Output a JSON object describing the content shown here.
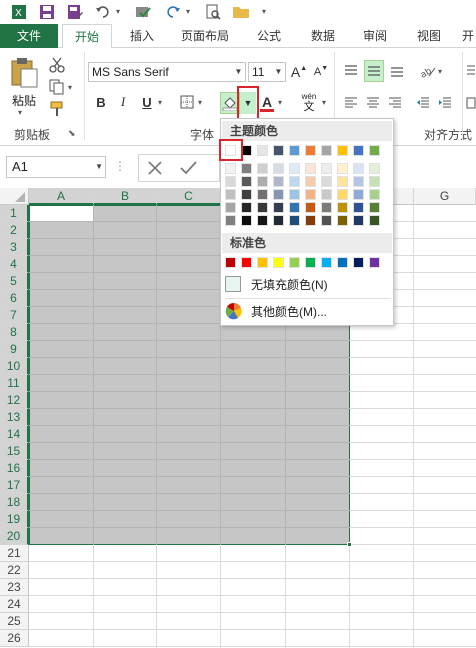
{
  "tabs": [
    "文件",
    "开始",
    "插入",
    "页面布局",
    "公式",
    "数据",
    "审阅",
    "视图",
    "开"
  ],
  "active_tab": "开始",
  "ribbon": {
    "paste_label": "粘贴",
    "clipboard_group": "剪贴板",
    "font_group": "字体",
    "align_group": "对齐方式",
    "font_name": "MS Sans Serif",
    "font_size": "11",
    "bold": "B",
    "italic": "I",
    "underline": "U",
    "font_color_glyph": "A",
    "wen_label": "wén",
    "wen_char": "文",
    "grow_font": "A",
    "shrink_font": "A"
  },
  "formula_bar": {
    "name_box": "A1"
  },
  "grid": {
    "columns": [
      "A",
      "B",
      "C",
      "D",
      "E",
      "F",
      "G"
    ],
    "rows": [
      "1",
      "2",
      "3",
      "4",
      "5",
      "6",
      "7",
      "8",
      "9",
      "10",
      "11",
      "12",
      "13",
      "14",
      "15",
      "16",
      "17",
      "18",
      "19",
      "20",
      "21",
      "22",
      "23",
      "24",
      "25",
      "26"
    ]
  },
  "dropdown": {
    "theme_title": "主题颜色",
    "standard_title": "标准色",
    "no_fill": "无填充颜色(N)",
    "more_colors": "其他颜色(M)...",
    "theme_top": [
      "#ffffff",
      "#000000",
      "#e7e6e6",
      "#44546a",
      "#5b9bd5",
      "#ed7d31",
      "#a5a5a5",
      "#ffc000",
      "#4472c4",
      "#70ad47"
    ],
    "theme_shades": [
      [
        "#f2f2f2",
        "#7f7f7f",
        "#d0cece",
        "#d6dce4",
        "#deebf6",
        "#fbe5d5",
        "#ededed",
        "#fff2cc",
        "#dae3f3",
        "#e2efd9"
      ],
      [
        "#d8d8d8",
        "#595959",
        "#aeabab",
        "#adb9ca",
        "#bdd7ee",
        "#f7cbac",
        "#dbdbdb",
        "#fee599",
        "#b4c6e7",
        "#c5e0b3"
      ],
      [
        "#bfbfbf",
        "#3f3f3f",
        "#757070",
        "#8496b0",
        "#9cc3e5",
        "#f4b183",
        "#c9c9c9",
        "#ffd965",
        "#8eaadb",
        "#a8d08d"
      ],
      [
        "#a5a5a5",
        "#262626",
        "#3a3838",
        "#323f4f",
        "#2e75b5",
        "#c55a11",
        "#7b7b7b",
        "#bf9000",
        "#2f5496",
        "#538135"
      ],
      [
        "#7f7f7f",
        "#0c0c0c",
        "#171616",
        "#222a35",
        "#1f4e79",
        "#833c0b",
        "#525252",
        "#7f6000",
        "#1f3864",
        "#375623"
      ]
    ],
    "standard": [
      "#c00000",
      "#ff0000",
      "#ffc000",
      "#ffff00",
      "#92d050",
      "#00b050",
      "#00b0f0",
      "#0070c0",
      "#002060",
      "#7030a0"
    ]
  },
  "colors": {
    "accent": "#217346",
    "selection": "#c6c6c6",
    "highlight": "#d9262c"
  }
}
